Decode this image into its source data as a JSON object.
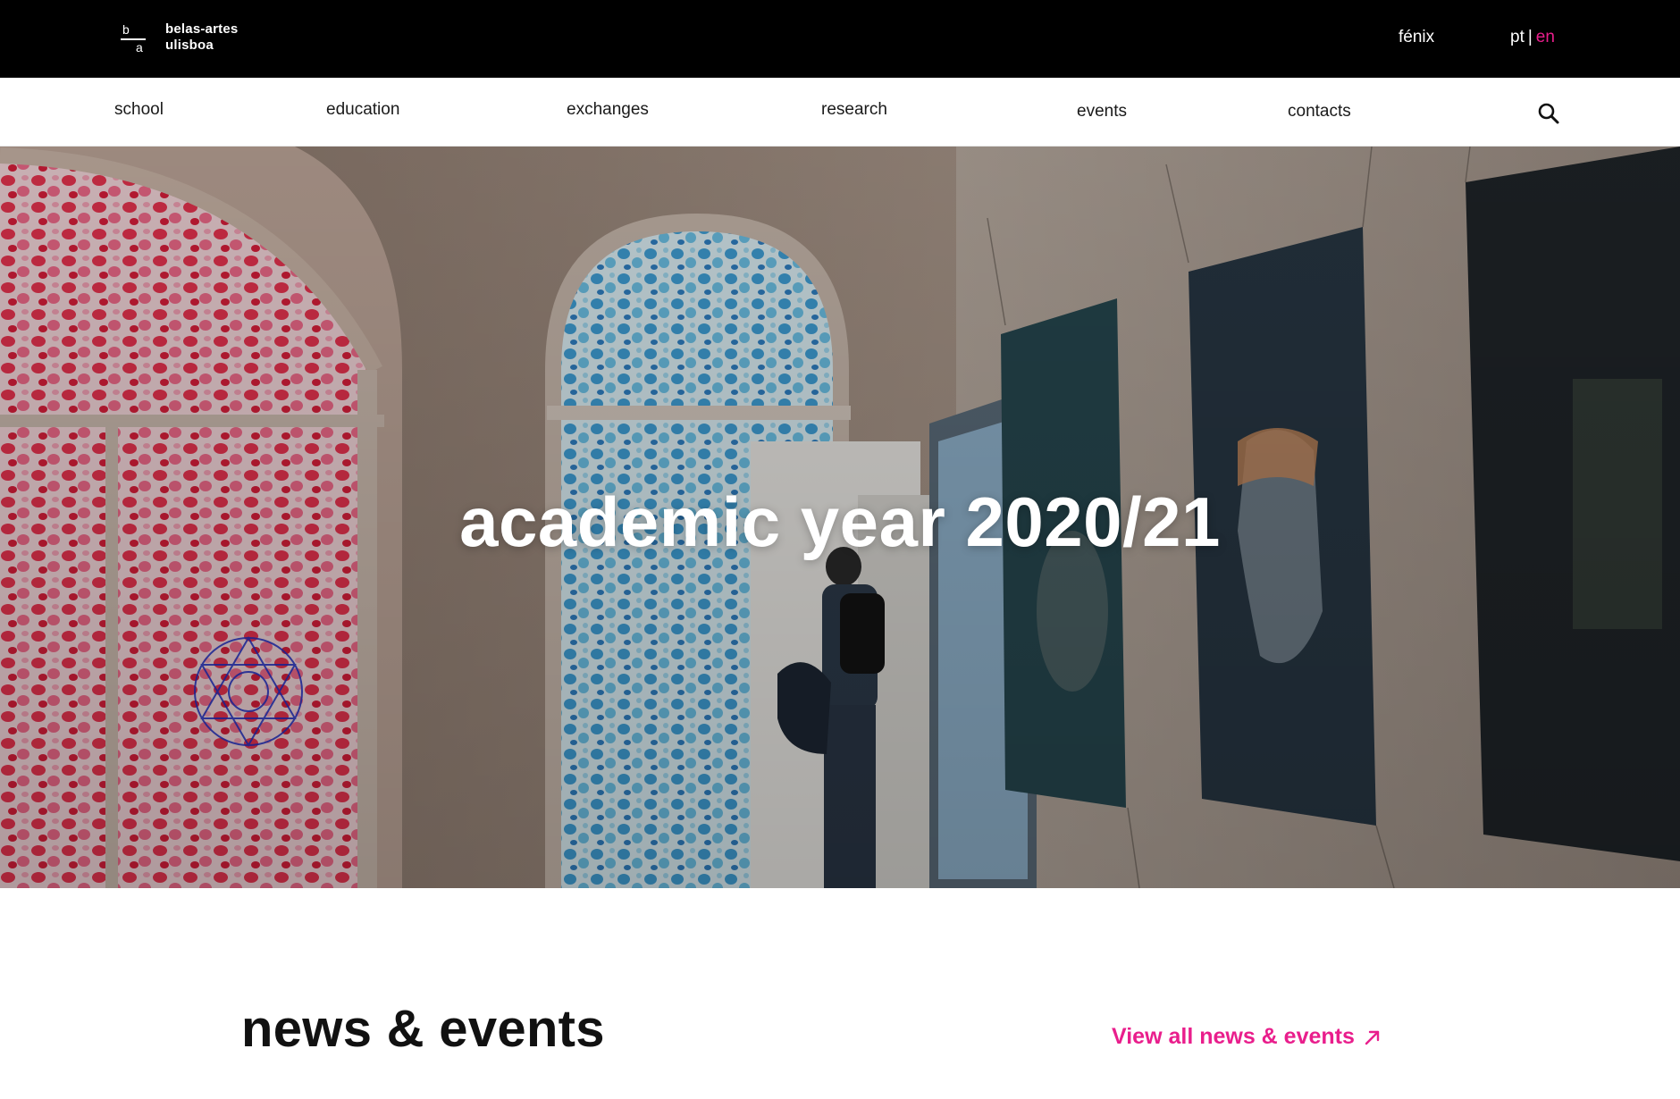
{
  "header": {
    "logo": {
      "mark_top": "b",
      "mark_bottom": "a",
      "line1": "belas-artes",
      "line2": "ulisboa"
    },
    "fenix": "fénix",
    "lang": {
      "pt": "pt",
      "separator": "|",
      "en": "en"
    }
  },
  "nav": {
    "items": [
      {
        "label": "school"
      },
      {
        "label": "education"
      },
      {
        "label": "exchanges"
      },
      {
        "label": "research"
      },
      {
        "label": "events"
      },
      {
        "label": "contacts"
      }
    ],
    "search_icon": "search-icon"
  },
  "hero": {
    "title": "academic year 2020/21"
  },
  "news": {
    "title": "news & events",
    "view_all": "View all news & events",
    "view_all_icon": "arrow-up-right-icon"
  },
  "colors": {
    "accent": "#e91e8c",
    "topbar": "#000000"
  }
}
